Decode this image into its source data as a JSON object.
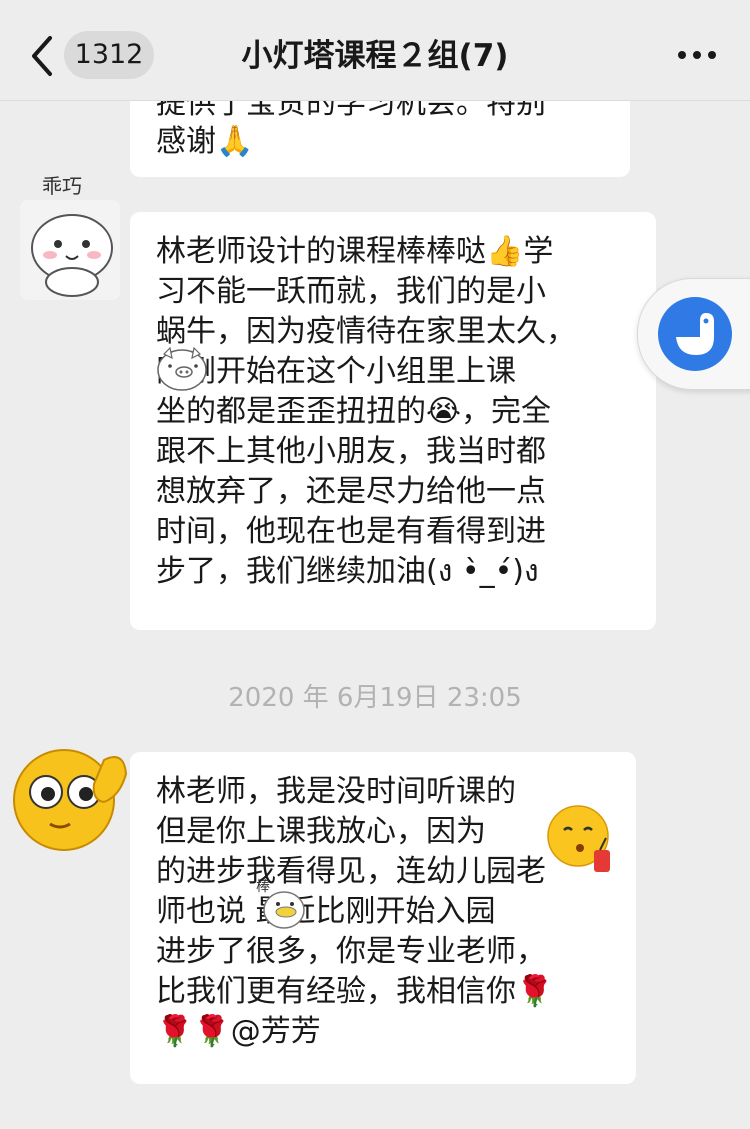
{
  "nav": {
    "unread_count": "1312",
    "title": "小灯塔课程２组(7)"
  },
  "icons": {
    "back": "chevron-left-icon",
    "more": "more-dots-icon",
    "float": "floating-bird-icon"
  },
  "colors": {
    "background": "#ededed",
    "bubble": "#ffffff",
    "accent": "#2f7ae5",
    "timestamp": "#b2b2b2"
  },
  "messages": [
    {
      "partial_cut_text": "提供了宝贵的学习机会。特别",
      "text": "感谢🙏"
    },
    {
      "sender_label": "乖巧",
      "text": "林老师设计的课程棒棒哒👍学习不能一跃而就，我们的是小蜗牛，因为疫情待在家里太久，刚刚开始在这个小组里上课坐的都是歪歪扭扭的😭，完全跟不上其他小朋友，我当时都想放弃了，还是尽力给他一点时间，他现在也是有看得到进步了，我们继续加油(ง •̀_•́)ง"
    },
    {
      "timestamp": "2020 年 6月19日 23:05"
    },
    {
      "text": "林老师，我是没时间听课的但是你上课我放心，因为  的进步我看得见，连幼儿园老师也说  最近比刚开始入园进步了很多，你是专业老师，比我们更有经验，我相信你🌹🌹🌹@芳芳"
    }
  ],
  "bubble_lines": {
    "msg1": [
      "感谢🙏"
    ],
    "msg2": [
      "林老师设计的课程棒棒哒👍学",
      "习不能一跃而就，我们的是小",
      "蜗牛，因为疫情待在家里太久，",
      "  刚刚开始在这个小组里上课",
      "坐的都是歪歪扭扭的😭，完全",
      "跟不上其他小朋友，我当时都",
      "想放弃了，还是尽力给他一点",
      "时间，他现在也是有看得到进",
      "步了，我们继续加油(ง •̀_•́)ง"
    ],
    "msg3": [
      "林老师，我是没时间听课的",
      "但是你上课我放心，因为",
      "的进步我看得见，连幼儿园老",
      "师也说  最近比刚开始入园",
      "进步了很多，你是专业老师，",
      "比我们更有经验，我相信你🌹",
      "🌹🌹@芳芳"
    ]
  },
  "stickers": {
    "sticker_tag": "棒"
  }
}
